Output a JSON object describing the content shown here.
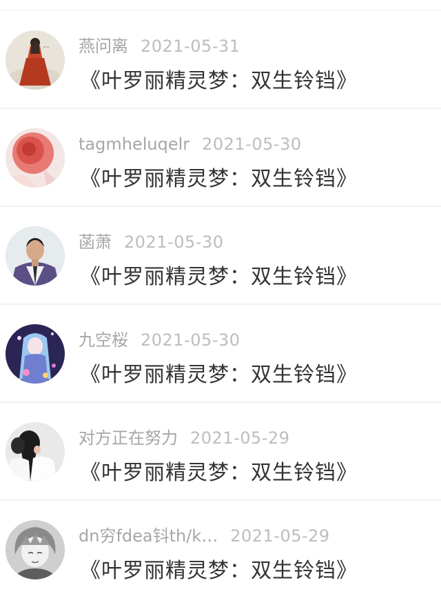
{
  "comments": [
    {
      "name": "燕问离",
      "date": "2021-05-31",
      "book": "《叶罗丽精灵梦：双生铃铛》",
      "avatar": "woman-red-dress-painting"
    },
    {
      "name": "tagmheluqelr",
      "date": "2021-05-30",
      "book": "《叶罗丽精灵梦：双生铃铛》",
      "avatar": "red-flower"
    },
    {
      "name": "菡萧",
      "date": "2021-05-30",
      "book": "《叶罗丽精灵梦：双生铃铛》",
      "avatar": "man-portrait"
    },
    {
      "name": "九空桜",
      "date": "2021-05-30",
      "book": "《叶罗丽精灵梦：双生铃铛》",
      "avatar": "anime-girl-blue"
    },
    {
      "name": "对方正在努力",
      "date": "2021-05-29",
      "book": "《叶罗丽精灵梦：双生铃铛》",
      "avatar": "couple-photo"
    },
    {
      "name": "dn穷fdea钭th/k…",
      "date": "2021-05-29",
      "book": "《叶罗丽精灵梦：双生铃铛》",
      "avatar": "anime-boy-sketch"
    }
  ],
  "colors": {
    "name_text": "#a6a6a6",
    "date_text": "#bdbdbd",
    "title_text": "#333333",
    "divider": "#f2f2f2"
  }
}
